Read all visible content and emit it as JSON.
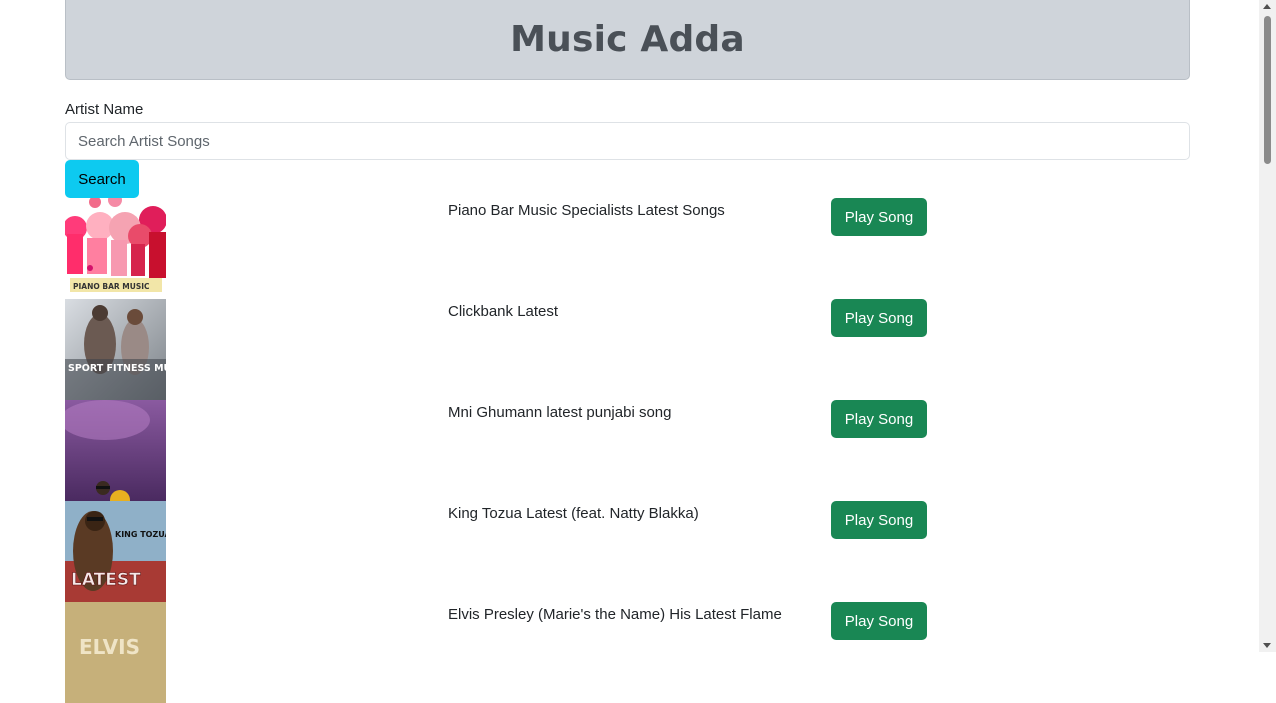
{
  "app": {
    "title": "Music Adda"
  },
  "search": {
    "label": "Artist Name",
    "placeholder": "Search Artist Songs",
    "value": "",
    "button_label": "Search"
  },
  "songs": [
    {
      "title": "Piano Bar Music Specialists Latest Songs",
      "play_label": "Play Song",
      "cover_text": "PIANO BAR MUSIC"
    },
    {
      "title": "Clickbank Latest",
      "play_label": "Play Song",
      "cover_text": "SPORT FITNESS MUSIC"
    },
    {
      "title": "Mni Ghumann latest punjabi song",
      "play_label": "Play Song",
      "cover_text": ""
    },
    {
      "title": "King Tozua Latest (feat. Natty Blakka)",
      "play_label": "Play Song",
      "cover_text": "KING TOZUA"
    },
    {
      "title": "Elvis Presley (Marie's the Name) His Latest Flame",
      "play_label": "Play Song",
      "cover_text": "ELVIS"
    }
  ],
  "colors": {
    "header_bg": "#cfd4da",
    "search_button": "#0dcaf0",
    "play_button": "#198754"
  }
}
